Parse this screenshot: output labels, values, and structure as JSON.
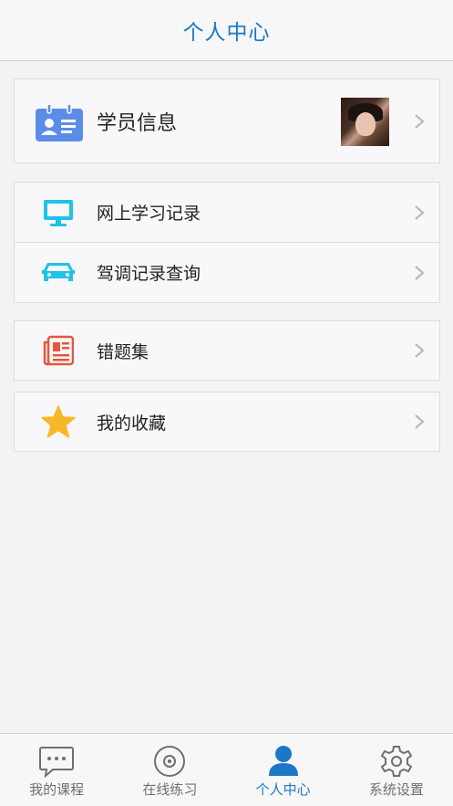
{
  "header": {
    "title": "个人中心"
  },
  "profile": {
    "label": "学员信息"
  },
  "group1": [
    {
      "label": "网上学习记录",
      "icon": "monitor-icon"
    },
    {
      "label": "驾调记录查询",
      "icon": "car-icon"
    }
  ],
  "group2": [
    {
      "label": "错题集",
      "icon": "newspaper-icon"
    }
  ],
  "group3": [
    {
      "label": "我的收藏",
      "icon": "star-icon"
    }
  ],
  "tabbar": [
    {
      "label": "我的课程",
      "icon": "chat-bubble-icon",
      "active": false
    },
    {
      "label": "在线练习",
      "icon": "disc-icon",
      "active": false
    },
    {
      "label": "个人中心",
      "icon": "user-icon",
      "active": true
    },
    {
      "label": "系统设置",
      "icon": "gear-icon",
      "active": false
    }
  ],
  "colors": {
    "accent": "#1c78c6",
    "id_card_icon": "#5b8de8",
    "monitor_icon": "#1ec3e6",
    "car_icon": "#1ec3e6",
    "newspaper_icon": "#e8563a",
    "star_icon": "#f5b829"
  }
}
